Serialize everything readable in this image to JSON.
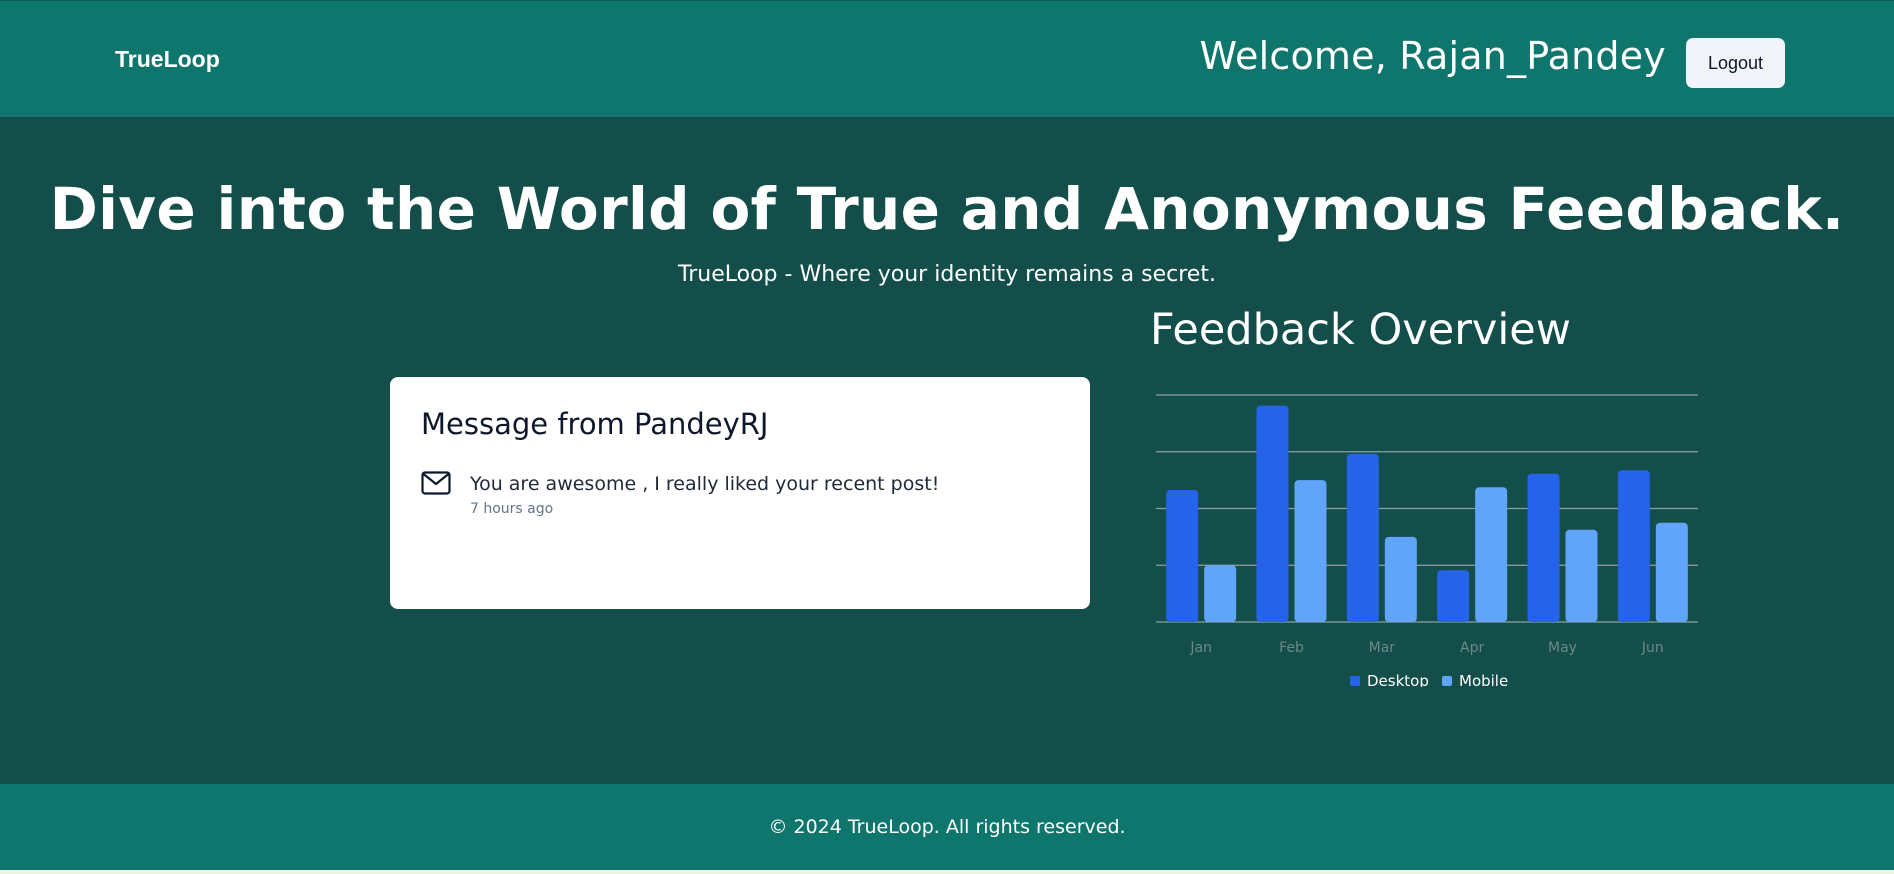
{
  "header": {
    "brand": "TrueLoop",
    "welcome": "Welcome, Rajan_Pandey",
    "logout_label": "Logout"
  },
  "hero": {
    "headline": "Dive into the World of True and Anonymous Feedback.",
    "subline": "TrueLoop - Where your identity remains a secret."
  },
  "message_card": {
    "title": "Message from PandeyRJ",
    "icon": "mail-icon",
    "text": "You are awesome , I really liked your recent post!",
    "time": "7 hours ago"
  },
  "chart_section": {
    "title": "Feedback Overview"
  },
  "chart_data": {
    "type": "bar",
    "title": "Feedback Overview",
    "categories": [
      "Jan",
      "Feb",
      "Mar",
      "Apr",
      "May",
      "Jun"
    ],
    "series": [
      {
        "name": "Desktop",
        "color": "#2563eb",
        "values": [
          186,
          305,
          237,
          73,
          209,
          214
        ]
      },
      {
        "name": "Mobile",
        "color": "#60a5fa",
        "values": [
          80,
          200,
          120,
          190,
          130,
          140
        ]
      }
    ],
    "ylim": [
      0,
      320
    ],
    "grid": true,
    "legend": "bottom-center"
  },
  "footer": {
    "text": "© 2024 TrueLoop. All rights reserved."
  },
  "colors": {
    "header_bg": "#0f766e",
    "main_bg": "#134e4a",
    "desktop": "#2563eb",
    "mobile": "#60a5fa"
  }
}
